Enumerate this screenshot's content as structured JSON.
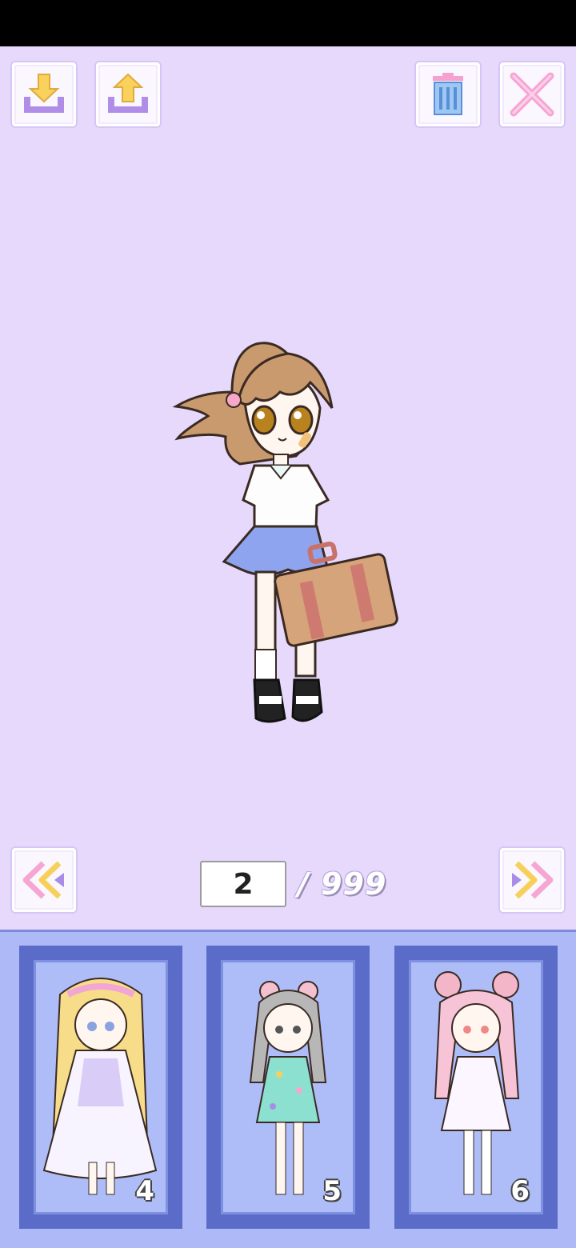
{
  "toolbar": {
    "download_icon": "download-icon",
    "upload_icon": "upload-icon",
    "trash_icon": "trash-icon",
    "close_icon": "close-icon"
  },
  "navigation": {
    "prev_icon": "double-chevron-left-icon",
    "next_icon": "double-chevron-right-icon"
  },
  "pager": {
    "current_page": "2",
    "total": "/ 999"
  },
  "slots": [
    {
      "number": "4"
    },
    {
      "number": "5"
    },
    {
      "number": "6"
    }
  ],
  "colors": {
    "stage_background": "#e7d9fb",
    "tray_background": "#aeb9f7",
    "slot_frame": "#5b6cc8",
    "accent_yellow": "#f7d15a",
    "accent_purple": "#a98ce8",
    "accent_pink": "#f5a3d6",
    "accent_blue": "#6aa6e8"
  }
}
